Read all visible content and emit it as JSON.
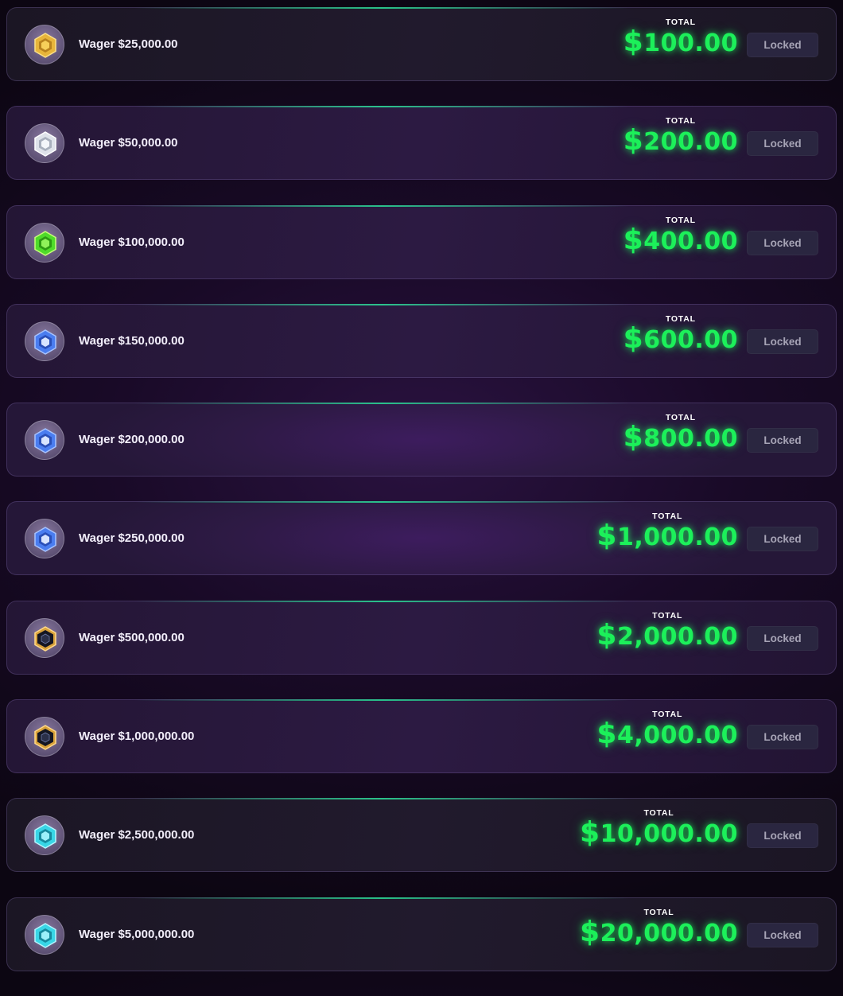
{
  "tiers": [
    {
      "label": "Wager $25,000.00",
      "total_caption": "TOTAL",
      "amount": "100.00",
      "currency": "$",
      "status": "Locked",
      "badge_icon": "gold-rank-icon",
      "badge_color": "#e8b53a"
    },
    {
      "label": "Wager $50,000.00",
      "total_caption": "TOTAL",
      "amount": "200.00",
      "currency": "$",
      "status": "Locked",
      "badge_icon": "silver-rank-icon",
      "badge_color": "#dfe3ea"
    },
    {
      "label": "Wager $100,000.00",
      "total_caption": "TOTAL",
      "amount": "400.00",
      "currency": "$",
      "status": "Locked",
      "badge_icon": "emerald-rank-icon",
      "badge_color": "#4fdc2a"
    },
    {
      "label": "Wager $150,000.00",
      "total_caption": "TOTAL",
      "amount": "600.00",
      "currency": "$",
      "status": "Locked",
      "badge_icon": "sapphire-rank-icon",
      "badge_color": "#4a7df0"
    },
    {
      "label": "Wager $200,000.00",
      "total_caption": "TOTAL",
      "amount": "800.00",
      "currency": "$",
      "status": "Locked",
      "badge_icon": "sapphire-rank-icon",
      "badge_color": "#4a7df0"
    },
    {
      "label": "Wager $250,000.00",
      "total_caption": "TOTAL",
      "amount": "1,000.00",
      "currency": "$",
      "status": "Locked",
      "badge_icon": "sapphire-rank-icon",
      "badge_color": "#4a7df0"
    },
    {
      "label": "Wager $500,000.00",
      "total_caption": "TOTAL",
      "amount": "2,000.00",
      "currency": "$",
      "status": "Locked",
      "badge_icon": "onyx-gold-rank-icon",
      "badge_color": "#d9a23a"
    },
    {
      "label": "Wager $1,000,000.00",
      "total_caption": "TOTAL",
      "amount": "4,000.00",
      "currency": "$",
      "status": "Locked",
      "badge_icon": "onyx-gold-rank-icon",
      "badge_color": "#d9a23a"
    },
    {
      "label": "Wager $2,500,000.00",
      "total_caption": "TOTAL",
      "amount": "10,000.00",
      "currency": "$",
      "status": "Locked",
      "badge_icon": "diamond-rank-icon",
      "badge_color": "#38d6e6"
    },
    {
      "label": "Wager $5,000,000.00",
      "total_caption": "TOTAL",
      "amount": "20,000.00",
      "currency": "$",
      "status": "Locked",
      "badge_icon": "diamond-rank-icon",
      "badge_color": "#38d6e6"
    }
  ],
  "colors": {
    "amount_green": "#1cf05a",
    "accent_line": "#28dc96",
    "locked_bg": "#2a2640",
    "locked_text": "#a7a4b6"
  }
}
